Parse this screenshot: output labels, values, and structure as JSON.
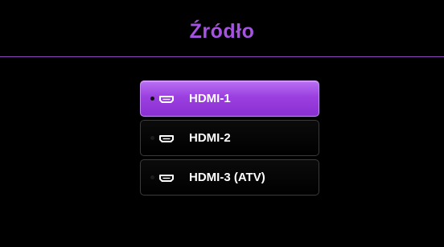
{
  "title": "Źródło",
  "accent_color": "#a553e0",
  "sources": [
    {
      "label": "HDMI-1",
      "icon": "hdmi-port-icon",
      "selected": true
    },
    {
      "label": "HDMI-2",
      "icon": "hdmi-port-icon",
      "selected": false
    },
    {
      "label": "HDMI-3 (ATV)",
      "icon": "hdmi-port-icon",
      "selected": false
    }
  ]
}
